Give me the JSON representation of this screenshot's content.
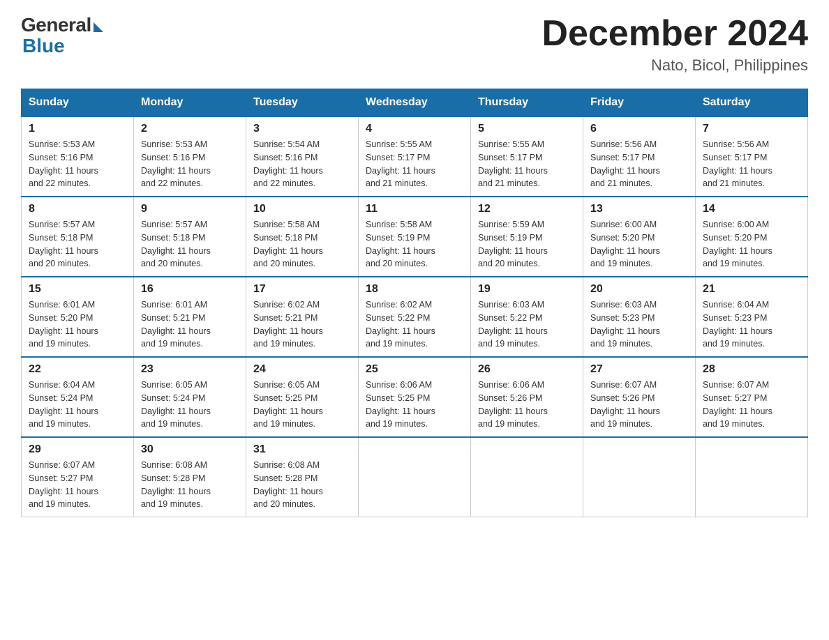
{
  "header": {
    "logo_general": "General",
    "logo_blue": "Blue",
    "month_title": "December 2024",
    "location": "Nato, Bicol, Philippines"
  },
  "weekdays": [
    "Sunday",
    "Monday",
    "Tuesday",
    "Wednesday",
    "Thursday",
    "Friday",
    "Saturday"
  ],
  "weeks": [
    [
      {
        "day": "1",
        "info": "Sunrise: 5:53 AM\nSunset: 5:16 PM\nDaylight: 11 hours\nand 22 minutes."
      },
      {
        "day": "2",
        "info": "Sunrise: 5:53 AM\nSunset: 5:16 PM\nDaylight: 11 hours\nand 22 minutes."
      },
      {
        "day": "3",
        "info": "Sunrise: 5:54 AM\nSunset: 5:16 PM\nDaylight: 11 hours\nand 22 minutes."
      },
      {
        "day": "4",
        "info": "Sunrise: 5:55 AM\nSunset: 5:17 PM\nDaylight: 11 hours\nand 21 minutes."
      },
      {
        "day": "5",
        "info": "Sunrise: 5:55 AM\nSunset: 5:17 PM\nDaylight: 11 hours\nand 21 minutes."
      },
      {
        "day": "6",
        "info": "Sunrise: 5:56 AM\nSunset: 5:17 PM\nDaylight: 11 hours\nand 21 minutes."
      },
      {
        "day": "7",
        "info": "Sunrise: 5:56 AM\nSunset: 5:17 PM\nDaylight: 11 hours\nand 21 minutes."
      }
    ],
    [
      {
        "day": "8",
        "info": "Sunrise: 5:57 AM\nSunset: 5:18 PM\nDaylight: 11 hours\nand 20 minutes."
      },
      {
        "day": "9",
        "info": "Sunrise: 5:57 AM\nSunset: 5:18 PM\nDaylight: 11 hours\nand 20 minutes."
      },
      {
        "day": "10",
        "info": "Sunrise: 5:58 AM\nSunset: 5:18 PM\nDaylight: 11 hours\nand 20 minutes."
      },
      {
        "day": "11",
        "info": "Sunrise: 5:58 AM\nSunset: 5:19 PM\nDaylight: 11 hours\nand 20 minutes."
      },
      {
        "day": "12",
        "info": "Sunrise: 5:59 AM\nSunset: 5:19 PM\nDaylight: 11 hours\nand 20 minutes."
      },
      {
        "day": "13",
        "info": "Sunrise: 6:00 AM\nSunset: 5:20 PM\nDaylight: 11 hours\nand 19 minutes."
      },
      {
        "day": "14",
        "info": "Sunrise: 6:00 AM\nSunset: 5:20 PM\nDaylight: 11 hours\nand 19 minutes."
      }
    ],
    [
      {
        "day": "15",
        "info": "Sunrise: 6:01 AM\nSunset: 5:20 PM\nDaylight: 11 hours\nand 19 minutes."
      },
      {
        "day": "16",
        "info": "Sunrise: 6:01 AM\nSunset: 5:21 PM\nDaylight: 11 hours\nand 19 minutes."
      },
      {
        "day": "17",
        "info": "Sunrise: 6:02 AM\nSunset: 5:21 PM\nDaylight: 11 hours\nand 19 minutes."
      },
      {
        "day": "18",
        "info": "Sunrise: 6:02 AM\nSunset: 5:22 PM\nDaylight: 11 hours\nand 19 minutes."
      },
      {
        "day": "19",
        "info": "Sunrise: 6:03 AM\nSunset: 5:22 PM\nDaylight: 11 hours\nand 19 minutes."
      },
      {
        "day": "20",
        "info": "Sunrise: 6:03 AM\nSunset: 5:23 PM\nDaylight: 11 hours\nand 19 minutes."
      },
      {
        "day": "21",
        "info": "Sunrise: 6:04 AM\nSunset: 5:23 PM\nDaylight: 11 hours\nand 19 minutes."
      }
    ],
    [
      {
        "day": "22",
        "info": "Sunrise: 6:04 AM\nSunset: 5:24 PM\nDaylight: 11 hours\nand 19 minutes."
      },
      {
        "day": "23",
        "info": "Sunrise: 6:05 AM\nSunset: 5:24 PM\nDaylight: 11 hours\nand 19 minutes."
      },
      {
        "day": "24",
        "info": "Sunrise: 6:05 AM\nSunset: 5:25 PM\nDaylight: 11 hours\nand 19 minutes."
      },
      {
        "day": "25",
        "info": "Sunrise: 6:06 AM\nSunset: 5:25 PM\nDaylight: 11 hours\nand 19 minutes."
      },
      {
        "day": "26",
        "info": "Sunrise: 6:06 AM\nSunset: 5:26 PM\nDaylight: 11 hours\nand 19 minutes."
      },
      {
        "day": "27",
        "info": "Sunrise: 6:07 AM\nSunset: 5:26 PM\nDaylight: 11 hours\nand 19 minutes."
      },
      {
        "day": "28",
        "info": "Sunrise: 6:07 AM\nSunset: 5:27 PM\nDaylight: 11 hours\nand 19 minutes."
      }
    ],
    [
      {
        "day": "29",
        "info": "Sunrise: 6:07 AM\nSunset: 5:27 PM\nDaylight: 11 hours\nand 19 minutes."
      },
      {
        "day": "30",
        "info": "Sunrise: 6:08 AM\nSunset: 5:28 PM\nDaylight: 11 hours\nand 19 minutes."
      },
      {
        "day": "31",
        "info": "Sunrise: 6:08 AM\nSunset: 5:28 PM\nDaylight: 11 hours\nand 20 minutes."
      },
      {
        "day": "",
        "info": ""
      },
      {
        "day": "",
        "info": ""
      },
      {
        "day": "",
        "info": ""
      },
      {
        "day": "",
        "info": ""
      }
    ]
  ]
}
